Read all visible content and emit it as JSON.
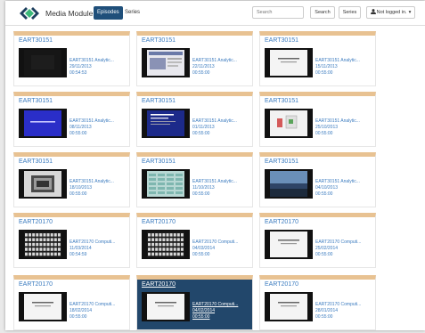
{
  "nav": {
    "brand": "Media Module",
    "tabs": [
      "Episodes",
      "Series"
    ],
    "search_placeholder": "Search",
    "search_button": "Search",
    "series_button": "Series",
    "login_label": "Not logged in.",
    "caret": "▾",
    "accent": "#1f4f7a"
  },
  "colors": {
    "card_accent": "#e8c292",
    "link": "#3b7bbf",
    "selected_bg": "#22476b"
  },
  "episodes": [
    {
      "series": "EART30151",
      "title": "EART30151 Analytic...",
      "date": "29/11/2013",
      "duration": "00:54:53",
      "thumb": "dark"
    },
    {
      "series": "EART30151",
      "title": "EART30151 Analytic...",
      "date": "22/11/2013",
      "duration": "00:55:00",
      "thumb": "website"
    },
    {
      "series": "EART30151",
      "title": "EART30151 Analytic...",
      "date": "15/11/2013",
      "duration": "00:55:00",
      "thumb": "white-slide"
    },
    {
      "series": "EART30151",
      "title": "EART30151 Analytic...",
      "date": "08/11/2013",
      "duration": "00:55:00",
      "thumb": "blue-slide"
    },
    {
      "series": "EART30151",
      "title": "EART30151 Analytic...",
      "date": "01/11/2013",
      "duration": "00:55:00",
      "thumb": "blue-text"
    },
    {
      "series": "EART30151",
      "title": "EART30151 Analytic...",
      "date": "25/10/2013",
      "duration": "00:55:00",
      "thumb": "diagram"
    },
    {
      "series": "EART30151",
      "title": "EART30151 Analytic...",
      "date": "18/10/2013",
      "duration": "00:55:00",
      "thumb": "photo"
    },
    {
      "series": "EART30151",
      "title": "EART30151 Analytic...",
      "date": "11/10/2013",
      "duration": "00:55:00",
      "thumb": "spreadsheet"
    },
    {
      "series": "EART30151",
      "title": "EART30151 Analytic...",
      "date": "04/10/2013",
      "duration": "00:55:00",
      "thumb": "landscape"
    },
    {
      "series": "EART20170",
      "title": "EART20170 Computi...",
      "date": "11/03/2014",
      "duration": "00:54:59",
      "thumb": "keyboard"
    },
    {
      "series": "EART20170",
      "title": "EART20170 Computi...",
      "date": "04/03/2014",
      "duration": "00:55:00",
      "thumb": "keyboard"
    },
    {
      "series": "EART20170",
      "title": "EART20170 Computi...",
      "date": "25/02/2014",
      "duration": "00:55:00",
      "thumb": "white-slide"
    },
    {
      "series": "EART20170",
      "title": "EART20170 Computi...",
      "date": "18/02/2014",
      "duration": "00:55:00",
      "thumb": "white-slide"
    },
    {
      "series": "EART20170",
      "title": "EART20170 Computi...",
      "date": "04/02/2014",
      "duration": "00:55:00",
      "thumb": "white-slide",
      "selected": true
    },
    {
      "series": "EART20170",
      "title": "EART20170 Computi...",
      "date": "28/01/2014",
      "duration": "00:55:00",
      "thumb": "white-slide"
    }
  ]
}
